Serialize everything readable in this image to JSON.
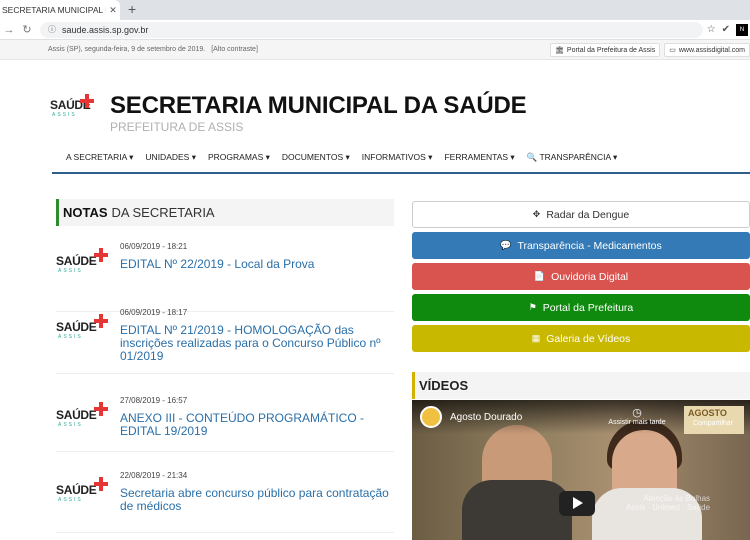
{
  "browser": {
    "tab_title": "SECRETARIA MUNICIPAL DE SAÚ",
    "tab_close": "✕",
    "new_tab": "+",
    "url": "saude.assis.sp.gov.br"
  },
  "infobar": {
    "date": "Assis (SP), segunda-feira, 9 de setembro de 2019.",
    "contrast": "[Alto contraste]",
    "links": [
      "Portal da Prefeitura de Assis",
      "www.assisdigital.com"
    ]
  },
  "header": {
    "logo_text": "SAÚDE",
    "logo_sub": "ASSIS",
    "title": "SECRETARIA MUNICIPAL DA SAÚDE",
    "subtitle": "PREFEITURA DE ASSIS"
  },
  "nav": [
    "A SECRETARIA ▾",
    "UNIDADES ▾",
    "PROGRAMAS ▾",
    "DOCUMENTOS ▾",
    "INFORMATIVOS ▾",
    "FERRAMENTAS ▾",
    "🔍 TRANSPARÊNCIA ▾"
  ],
  "notes": {
    "heading_bold": "NOTAS",
    "heading_rest": "DA SECRETARIA",
    "items": [
      {
        "date": "06/09/2019 - 18:21",
        "title": "EDITAL Nº 22/2019 - Local da Prova"
      },
      {
        "date": "06/09/2019 - 18:17",
        "title": "EDITAL Nº 21/2019 - HOMOLOGAÇÃO das inscrições realizadas para o Concurso Público nº 01/2019"
      },
      {
        "date": "27/08/2019 - 16:57",
        "title": "ANEXO III - CONTEÚDO PROGRAMÁTICO - EDITAL 19/2019"
      },
      {
        "date": "22/08/2019 - 21:34",
        "title": "Secretaria abre concurso público para contratação de médicos"
      }
    ]
  },
  "quick_links": [
    {
      "label": "Radar da Dengue",
      "icon": "✥",
      "color": "#ffffff"
    },
    {
      "label": "Transparência - Medicamentos",
      "icon": "💬",
      "color": "#337ab7"
    },
    {
      "label": "Ouvidoria Digital",
      "icon": "📄",
      "color": "#d9534f"
    },
    {
      "label": "Portal da Prefeitura",
      "icon": "⚑",
      "color": "#0f8a0f"
    },
    {
      "label": "Galeria de Vídeos",
      "icon": "▦",
      "color": "#c9b800"
    }
  ],
  "videos": {
    "heading": "VÍDEOS",
    "video_title": "Agosto Dourado",
    "watch_later": "Assistir mais tarde",
    "share": "Compartilhar",
    "brand": "AGOSTO",
    "watermark": "Atenção às Bolhas\nAssis · Unimed · Saúde"
  }
}
